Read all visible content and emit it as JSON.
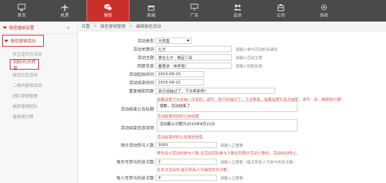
{
  "nav": {
    "items": [
      {
        "label": "首页",
        "icon": "monitor-icon",
        "active": false
      },
      {
        "label": "机票",
        "icon": "plane-icon",
        "active": false
      },
      {
        "label": "微信",
        "icon": "wechat-icon",
        "active": true
      },
      {
        "label": "商城",
        "icon": "store-icon",
        "active": false
      },
      {
        "label": "广告",
        "icon": "billboard-icon",
        "active": false
      },
      {
        "label": "会员",
        "icon": "members-icon",
        "active": false
      },
      {
        "label": "公司",
        "icon": "company-icon",
        "active": false
      },
      {
        "label": "系统",
        "icon": "gear-icon",
        "active": false
      }
    ]
  },
  "sidebar": {
    "group_label": "微信基础设置",
    "category_label": "微信营销活动",
    "links": [
      "关注送红包活动",
      "刮刮卡/大转盘",
      "微信红包活动",
      "二维码营销活动",
      "团队营销管理",
      "抽奖营销团队",
      "营销排行榜"
    ],
    "selected_index": 1
  },
  "breadcrumb": {
    "items": [
      "位置",
      "微信营销管理",
      "编辑微信活动"
    ]
  },
  "form": {
    "activity_type": {
      "label": "活动类型",
      "value": "大转盘"
    },
    "keyword": {
      "label": "活动关键词",
      "value": "七夕",
      "hint": "请输入参与活动的关键词"
    },
    "theme": {
      "label": "活动主题",
      "value": "爱在七夕 · 情定三亚",
      "hint": "请输入活动主题"
    },
    "reply": {
      "label": "回复信息",
      "value": "春意浓 · 申奖啦！",
      "hint": "请输入回复信息"
    },
    "start_time": {
      "label": "活动起始时间",
      "value": "2015-08-20"
    },
    "end_time": {
      "label": "活动结束时间",
      "value": "2015-08-22"
    },
    "repeat_prompt": {
      "label": "重复抽奖回复",
      "value": "亲已经抽过了，下次再来吧！",
      "note": "如果设置只允许抽一次奖的，请写：你已经抽过了，下次再来。如果设置可多次抽奖，请写：亲，继续努力哦！"
    },
    "end_notice": {
      "label": "活动结束公告标题",
      "value": "很歉，活动结束了",
      "note": "活动结束时间的公告标题"
    },
    "end_notice_desc": {
      "label": "活动结束信息说明",
      "value": "活动截止日期为2015年8月21日",
      "note": "活动结束时的公告描述信息"
    },
    "expected_count": {
      "label": "预计活动参与人数",
      "value": "3000",
      "hint": "请输入正整数",
      "note": "预先估计活动的参与人数,当活动实际参与人数达到预计活动人数时，活动自动停止。"
    },
    "daily_max": {
      "label": "每天可参与的总次数",
      "value": "2",
      "hint": "请输入正整数（每天所有人可参与的总次数）",
      "note": "在本次活动中,每天所有人可抽奖的总次数。"
    },
    "per_user": {
      "label": "每人可参与的总次数",
      "value": "4",
      "hint": "请输入正整数"
    }
  }
}
